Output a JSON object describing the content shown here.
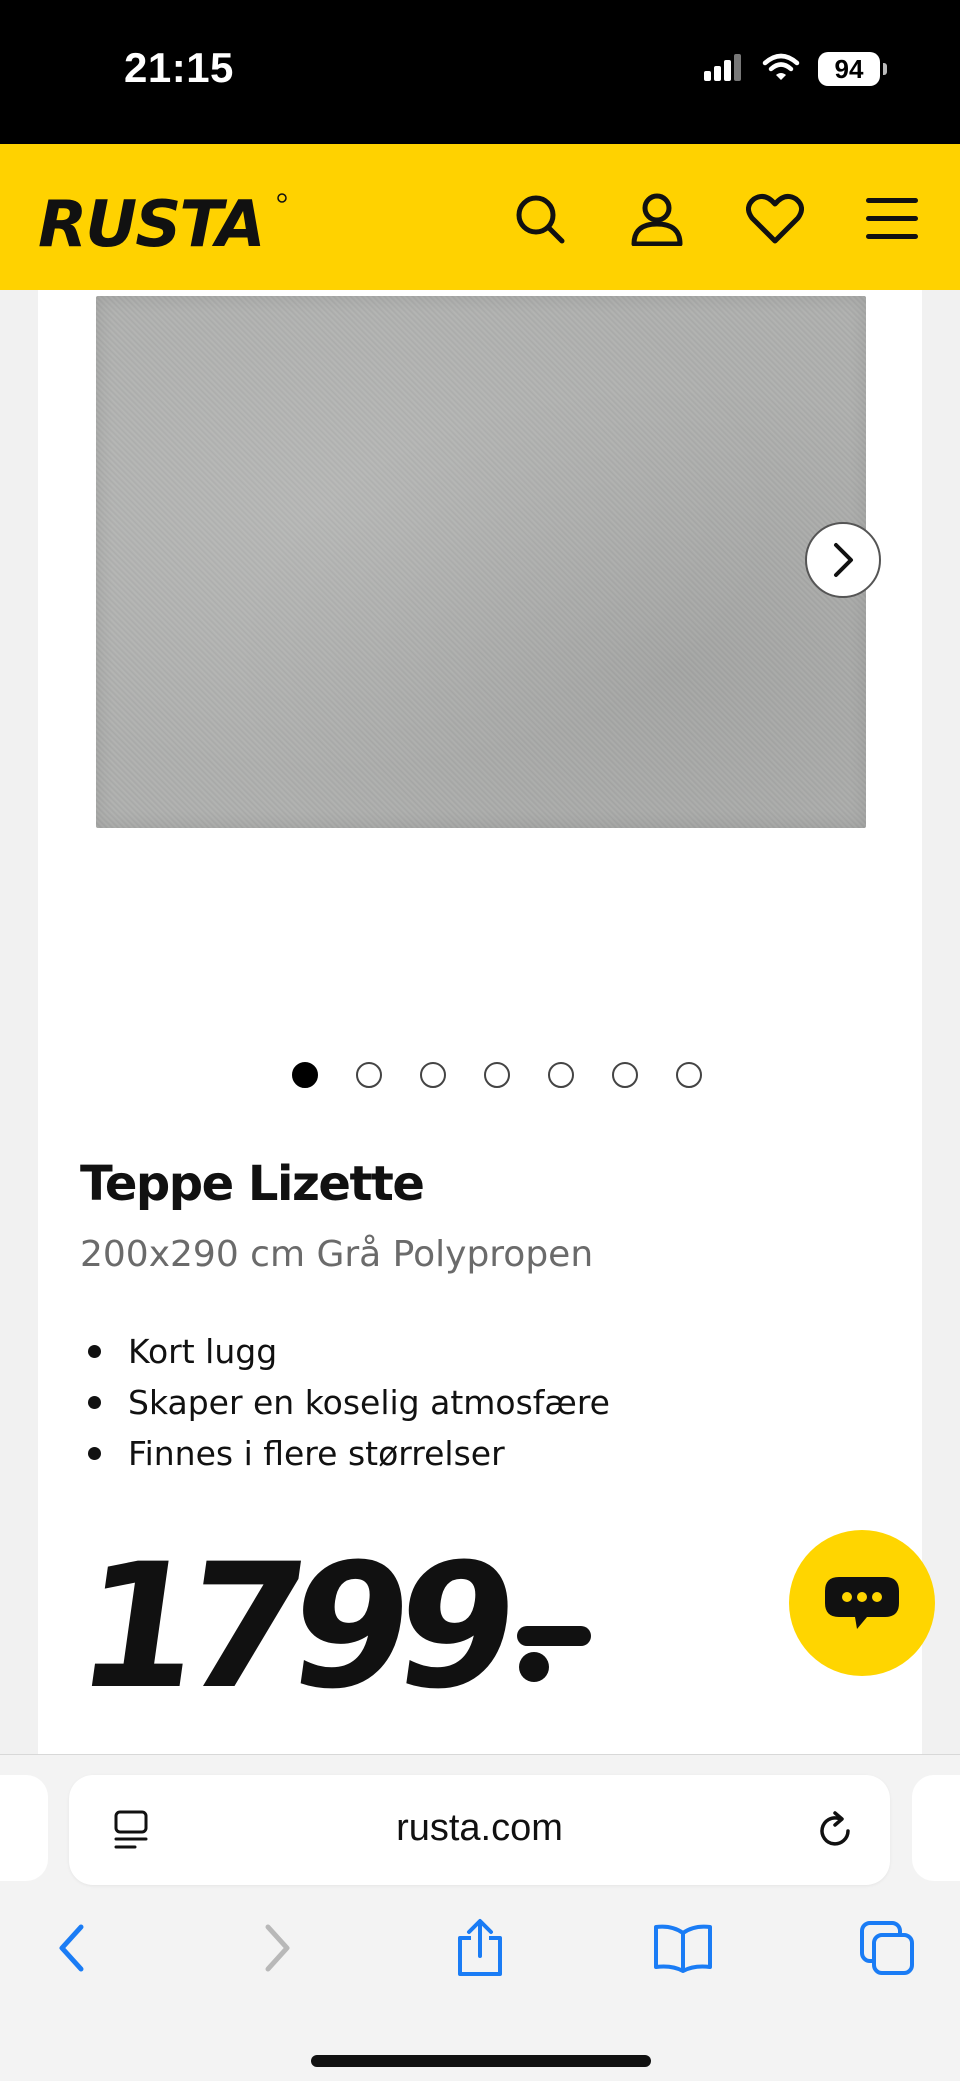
{
  "status_bar": {
    "time": "21:15",
    "battery": "94",
    "icons": [
      "signal-icon",
      "wifi-icon",
      "battery-icon"
    ]
  },
  "header": {
    "logo_text": "RUSTA",
    "icons": [
      "search-icon",
      "account-icon",
      "heart-icon",
      "menu-icon"
    ],
    "background_color": "#ffd200"
  },
  "product": {
    "title": "Teppe Lizette",
    "subtitle": "200x290 cm Grå Polypropen",
    "features": [
      "Kort lugg",
      "Skaper en koselig atmosfære",
      "Finnes i flere størrelser"
    ],
    "price": "1799",
    "image_count": 7,
    "active_image": 1
  },
  "chat": {
    "icon": "chat-icon",
    "color": "#ffd500"
  },
  "browser": {
    "url": "rusta.com",
    "icons": [
      "page-menu-icon",
      "reload-icon",
      "back-icon",
      "forward-icon",
      "share-icon",
      "bookmarks-icon",
      "tabs-icon"
    ]
  }
}
